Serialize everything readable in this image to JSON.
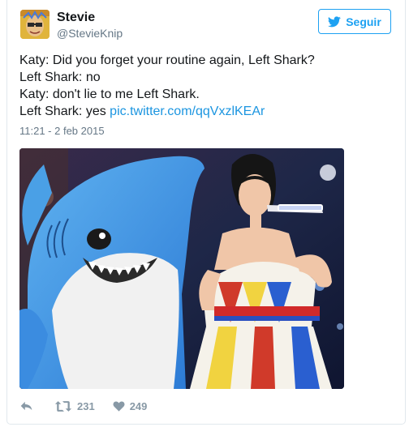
{
  "tweet": {
    "display_name": "Stevie",
    "handle": "@StevieKnip",
    "follow_label": "Seguir",
    "lines": [
      "Katy: Did you forget your routine again, Left Shark?",
      "Left Shark: no",
      "Katy: don't lie to me Left Shark.",
      "Left Shark: yes"
    ],
    "link": "pic.twitter.com/qqVxzlKEAr",
    "timestamp": "11:21 - 2 feb 2015",
    "retweet_count": "231",
    "like_count": "249"
  },
  "colors": {
    "brand_blue": "#1da1f2",
    "link_blue": "#1b95e0",
    "muted": "#8899a6"
  },
  "icons": {
    "follow": "twitter-bird-icon",
    "reply": "reply-icon",
    "retweet": "retweet-icon",
    "like": "heart-icon"
  }
}
